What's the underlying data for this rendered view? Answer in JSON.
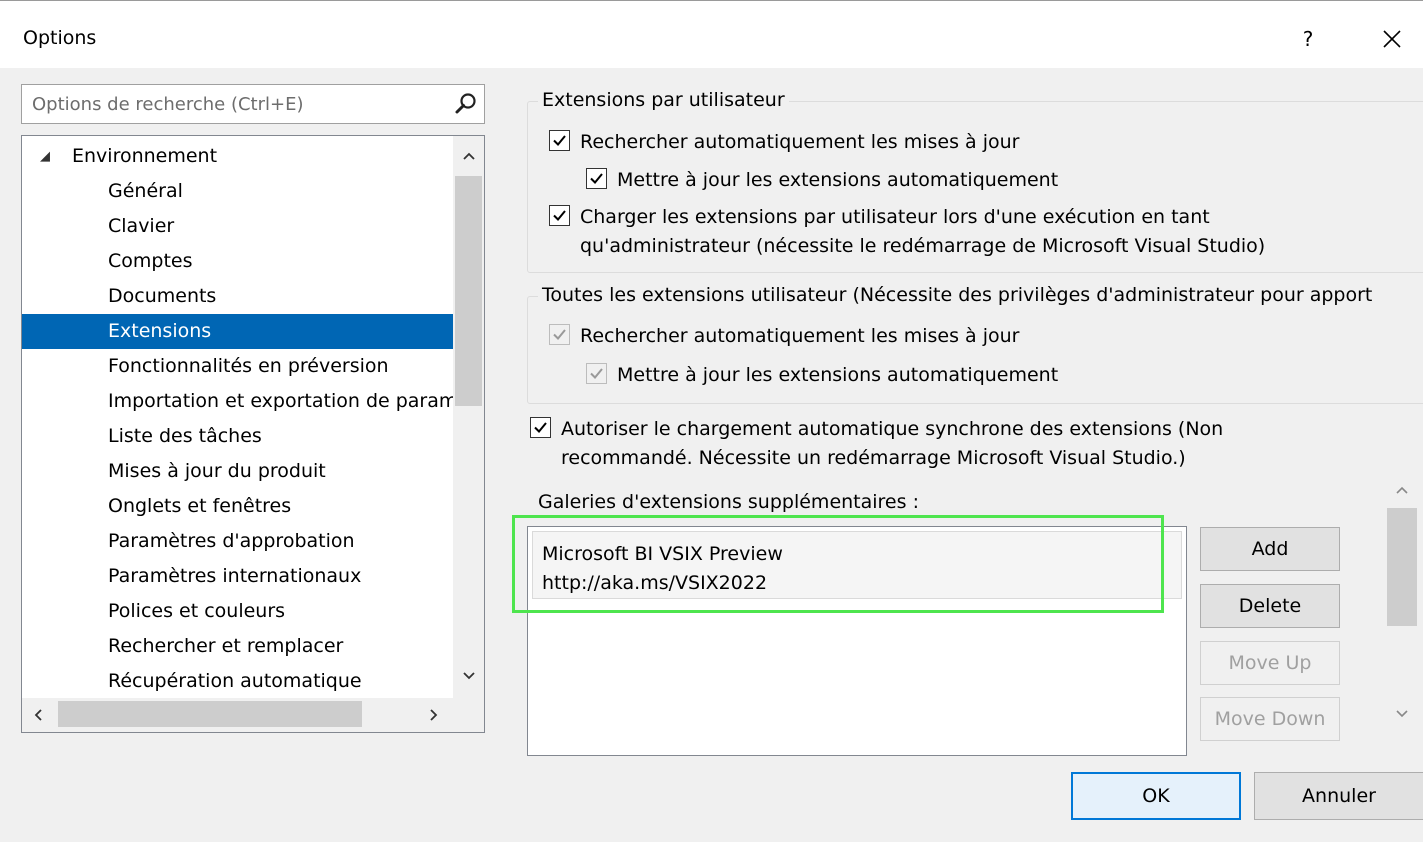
{
  "dialog": {
    "title": "Options",
    "help_label": "?"
  },
  "search": {
    "placeholder": "Options de recherche (Ctrl+E)"
  },
  "tree": {
    "root": "Environnement",
    "items": [
      "Général",
      "Clavier",
      "Comptes",
      "Documents",
      "Extensions",
      "Fonctionnalités en préversion",
      "Importation et exportation de paramètres",
      "Liste des tâches",
      "Mises à jour du produit",
      "Onglets et fenêtres",
      "Paramètres d'approbation",
      "Paramètres internationaux",
      "Polices et couleurs",
      "Rechercher et remplacer",
      "Récupération automatique"
    ],
    "selected": "Extensions"
  },
  "per_user": {
    "legend": "Extensions par utilisateur",
    "auto_check": {
      "label": "Rechercher automatiquement les mises à jour",
      "checked": true
    },
    "auto_update": {
      "label": "Mettre à jour les extensions automatiquement",
      "checked": true
    },
    "load_admin": {
      "line1": "Charger les extensions par utilisateur lors d'une exécution en tant",
      "line2": "qu'administrateur (nécessite le redémarrage de Microsoft Visual Studio)",
      "checked": true
    }
  },
  "all_users": {
    "legend": "Toutes les extensions utilisateur (Nécessite des privilèges d'administrateur pour apport",
    "auto_check": {
      "label": "Rechercher automatiquement les mises à jour",
      "checked": true,
      "disabled": true
    },
    "auto_update": {
      "label": "Mettre à jour les extensions automatiquement",
      "checked": true,
      "disabled": true
    }
  },
  "sync_load": {
    "line1": "Autoriser le chargement automatique synchrone des extensions (Non",
    "line2": "recommandé. Nécessite un redémarrage Microsoft Visual Studio.)",
    "checked": true
  },
  "galleries": {
    "label": "Galeries d'extensions supplémentaires :",
    "items": [
      {
        "name": "Microsoft BI VSIX Preview",
        "url": "http://aka.ms/VSIX2022"
      }
    ],
    "buttons": {
      "add": "Add",
      "delete": "Delete",
      "move_up": "Move Up",
      "move_down": "Move Down"
    }
  },
  "footer": {
    "ok": "OK",
    "cancel": "Annuler"
  },
  "colors": {
    "selection": "#0066b4",
    "highlight": "#4ee54e",
    "ok_border": "#0078d7"
  }
}
